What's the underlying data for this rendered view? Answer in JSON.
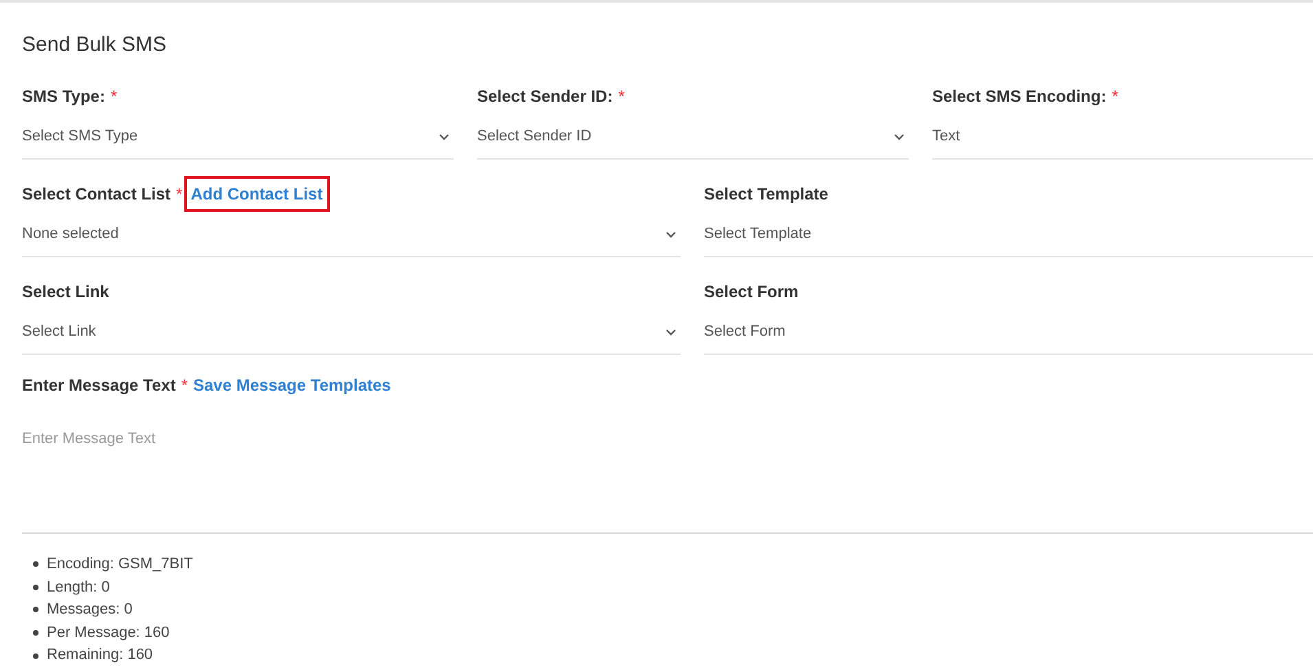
{
  "title": "Send Bulk SMS",
  "rows": [
    {
      "fields": [
        {
          "label": "SMS Type:",
          "required_mark": "*",
          "value": "Select SMS Type",
          "dropdown": true
        },
        {
          "label": "Select Sender ID:",
          "required_mark": "*",
          "value": "Select Sender ID",
          "dropdown": true
        },
        {
          "label": "Select SMS Encoding:",
          "required_mark": "*",
          "value": "Text",
          "dropdown": false
        }
      ]
    },
    {
      "fields": [
        {
          "label": "Select Contact List",
          "required_mark": "*",
          "link": {
            "text": "Add Contact List",
            "highlighted": true
          },
          "value": "None selected",
          "dropdown": true
        },
        {
          "label": "Select Template",
          "value": "Select Template",
          "dropdown": false
        }
      ]
    },
    {
      "fields": [
        {
          "label": "Select Link",
          "value": "Select Link",
          "dropdown": true
        },
        {
          "label": "Select Form",
          "value": "Select Form",
          "dropdown": false
        }
      ]
    }
  ],
  "message": {
    "label": "Enter Message Text",
    "required_mark": "*",
    "link": {
      "text": "Save Message Templates",
      "highlighted": false
    },
    "placeholder": "Enter Message Text"
  },
  "stats": [
    "Encoding: GSM_7BIT",
    "Length: 0",
    "Messages: 0",
    "Per Message: 160",
    "Remaining: 160"
  ]
}
